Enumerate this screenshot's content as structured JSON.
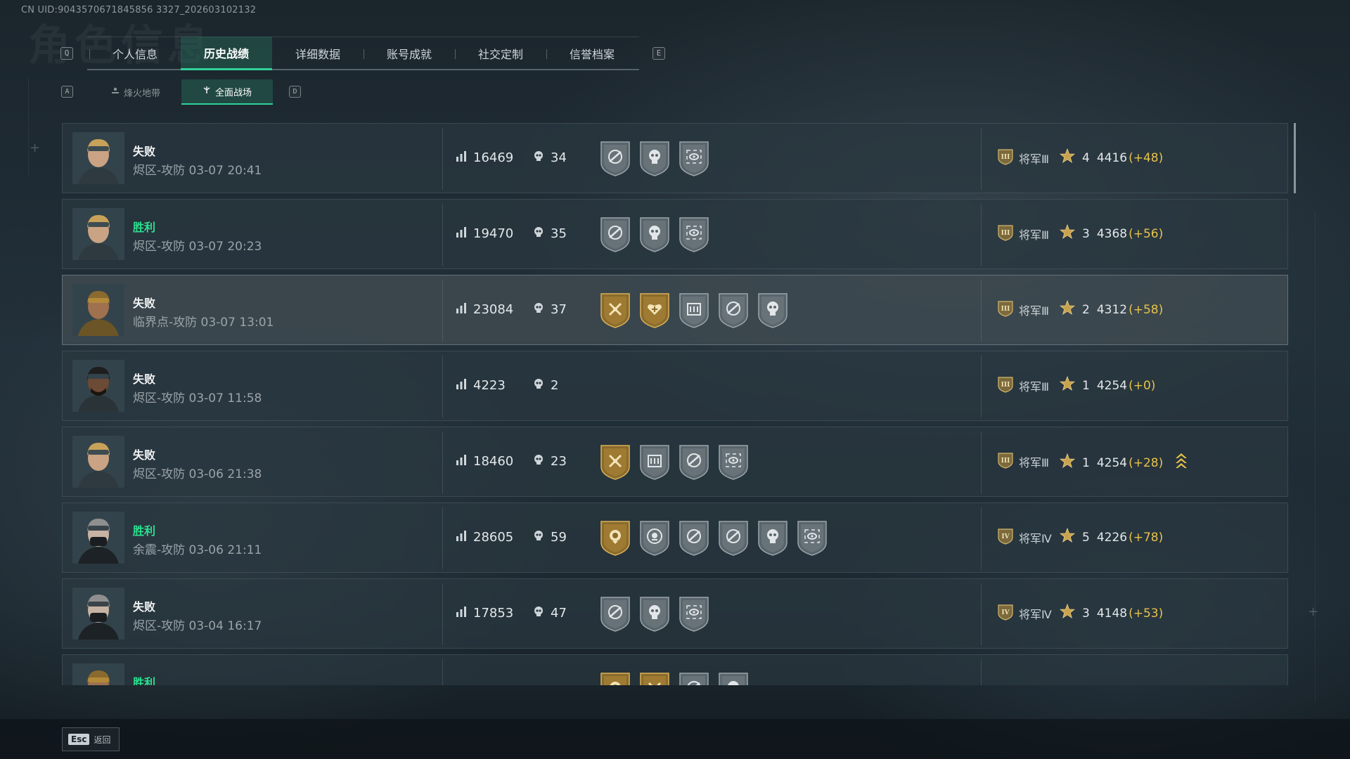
{
  "uid_text": "CN UID:9043570671845856 3327_202603102132",
  "bg_title": "角色信息",
  "tabs": {
    "left_key": "Q",
    "right_key": "E",
    "items": [
      "个人信息",
      "历史战绩",
      "详细数据",
      "账号成就",
      "社交定制",
      "信誉档案"
    ],
    "active_index": 1
  },
  "subtabs": {
    "left_key": "A",
    "right_key": "D",
    "items": [
      "烽火地带",
      "全面战场"
    ],
    "active_index": 1
  },
  "colors": {
    "accent": "#2fd29a",
    "win": "#2be08f",
    "delta": "#e8c24a"
  },
  "rows": [
    {
      "result": "失败",
      "win": false,
      "map": "烬区-攻防 03-07 20:41",
      "score": "16469",
      "kills": "34",
      "badges": [
        "silver-wing",
        "silver-skull",
        "silver-eye"
      ],
      "rank": "将军Ⅲ",
      "rank_icon": "rank-iii-icon",
      "stars": "4",
      "points": "4416",
      "delta": "(+48)",
      "avatar": "operator-blonde",
      "up": false
    },
    {
      "result": "胜利",
      "win": true,
      "map": "烬区-攻防 03-07 20:23",
      "score": "19470",
      "kills": "35",
      "badges": [
        "silver-wing",
        "silver-skull",
        "silver-eye"
      ],
      "rank": "将军Ⅲ",
      "rank_icon": "rank-iii-icon",
      "stars": "3",
      "points": "4368",
      "delta": "(+56)",
      "avatar": "operator-blonde",
      "up": false
    },
    {
      "result": "失败",
      "win": false,
      "map": "临界点-攻防 03-07 13:01",
      "score": "23084",
      "kills": "37",
      "badges": [
        "gold-hammer",
        "gold-heart",
        "silver-building",
        "silver-wing",
        "silver-skull"
      ],
      "rank": "将军Ⅲ",
      "rank_icon": "rank-iii-icon",
      "stars": "2",
      "points": "4312",
      "delta": "(+58)",
      "avatar": "operator-gold",
      "up": false,
      "highlight": true
    },
    {
      "result": "失败",
      "win": false,
      "map": "烬区-攻防 03-07 11:58",
      "score": "4223",
      "kills": "2",
      "badges": [],
      "rank": "将军Ⅲ",
      "rank_icon": "rank-iii-icon",
      "stars": "1",
      "points": "4254",
      "delta": "(+0)",
      "avatar": "operator-dark",
      "up": false
    },
    {
      "result": "失败",
      "win": false,
      "map": "烬区-攻防 03-06 21:38",
      "score": "18460",
      "kills": "23",
      "badges": [
        "gold-hammer",
        "silver-building",
        "silver-wing",
        "silver-eye"
      ],
      "rank": "将军Ⅲ",
      "rank_icon": "rank-iii-icon",
      "stars": "1",
      "points": "4254",
      "delta": "(+28)",
      "avatar": "operator-blonde",
      "up": true
    },
    {
      "result": "胜利",
      "win": true,
      "map": "余震-攻防 03-06 21:11",
      "score": "28605",
      "kills": "59",
      "badges": [
        "gold-crest",
        "silver-target",
        "silver-wing",
        "silver-wing",
        "silver-skull",
        "silver-eye"
      ],
      "rank": "将军Ⅳ",
      "rank_icon": "rank-iv-icon",
      "stars": "5",
      "points": "4226",
      "delta": "(+78)",
      "avatar": "operator-mask",
      "up": false
    },
    {
      "result": "失败",
      "win": false,
      "map": "烬区-攻防 03-04 16:17",
      "score": "17853",
      "kills": "47",
      "badges": [
        "silver-wing",
        "silver-skull",
        "silver-eye"
      ],
      "rank": "将军Ⅳ",
      "rank_icon": "rank-iv-icon",
      "stars": "3",
      "points": "4148",
      "delta": "(+53)",
      "avatar": "operator-mask",
      "up": false
    },
    {
      "result": "胜利",
      "win": true,
      "map": "",
      "score": "",
      "kills": "",
      "badges": [
        "gold-crest",
        "gold-hammer",
        "silver-wing",
        "silver-skull"
      ],
      "rank": "",
      "rank_icon": "rank-iv-icon",
      "stars": "",
      "points": "",
      "delta": "",
      "avatar": "operator-gold",
      "up": false
    }
  ],
  "footer": {
    "esc_key": "Esc",
    "back_label": "返回"
  }
}
